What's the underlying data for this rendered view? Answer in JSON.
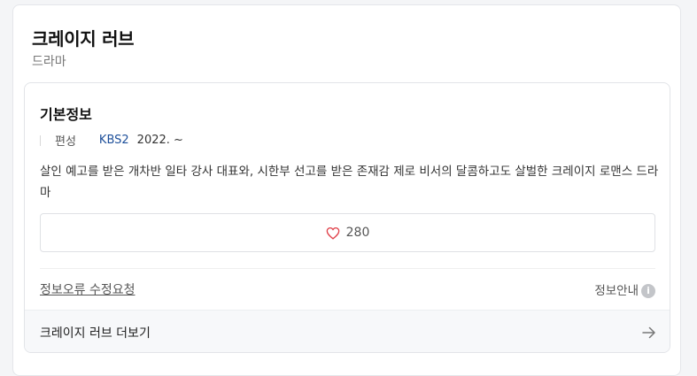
{
  "header": {
    "title": "크레이지 러브",
    "genre": "드라마"
  },
  "basic_info": {
    "section_title": "기본정보",
    "label": "편성",
    "channel": "KBS2",
    "date": "2022. ~",
    "description": "살인 예고를 받은 개차반 일타 강사 대표와, 시한부 선고를 받은 존재감 제로 비서의 달콤하고도 살벌한 크레이지 로맨스 드라마"
  },
  "like": {
    "count": "280",
    "icon": "heart-outline-icon",
    "color": "#e0424b"
  },
  "footer": {
    "report_link": "정보오류 수정요청",
    "info_guide": "정보안내",
    "info_icon": "info-icon",
    "more_label": "크레이지 러브 더보기",
    "more_icon": "arrow-right-icon"
  }
}
